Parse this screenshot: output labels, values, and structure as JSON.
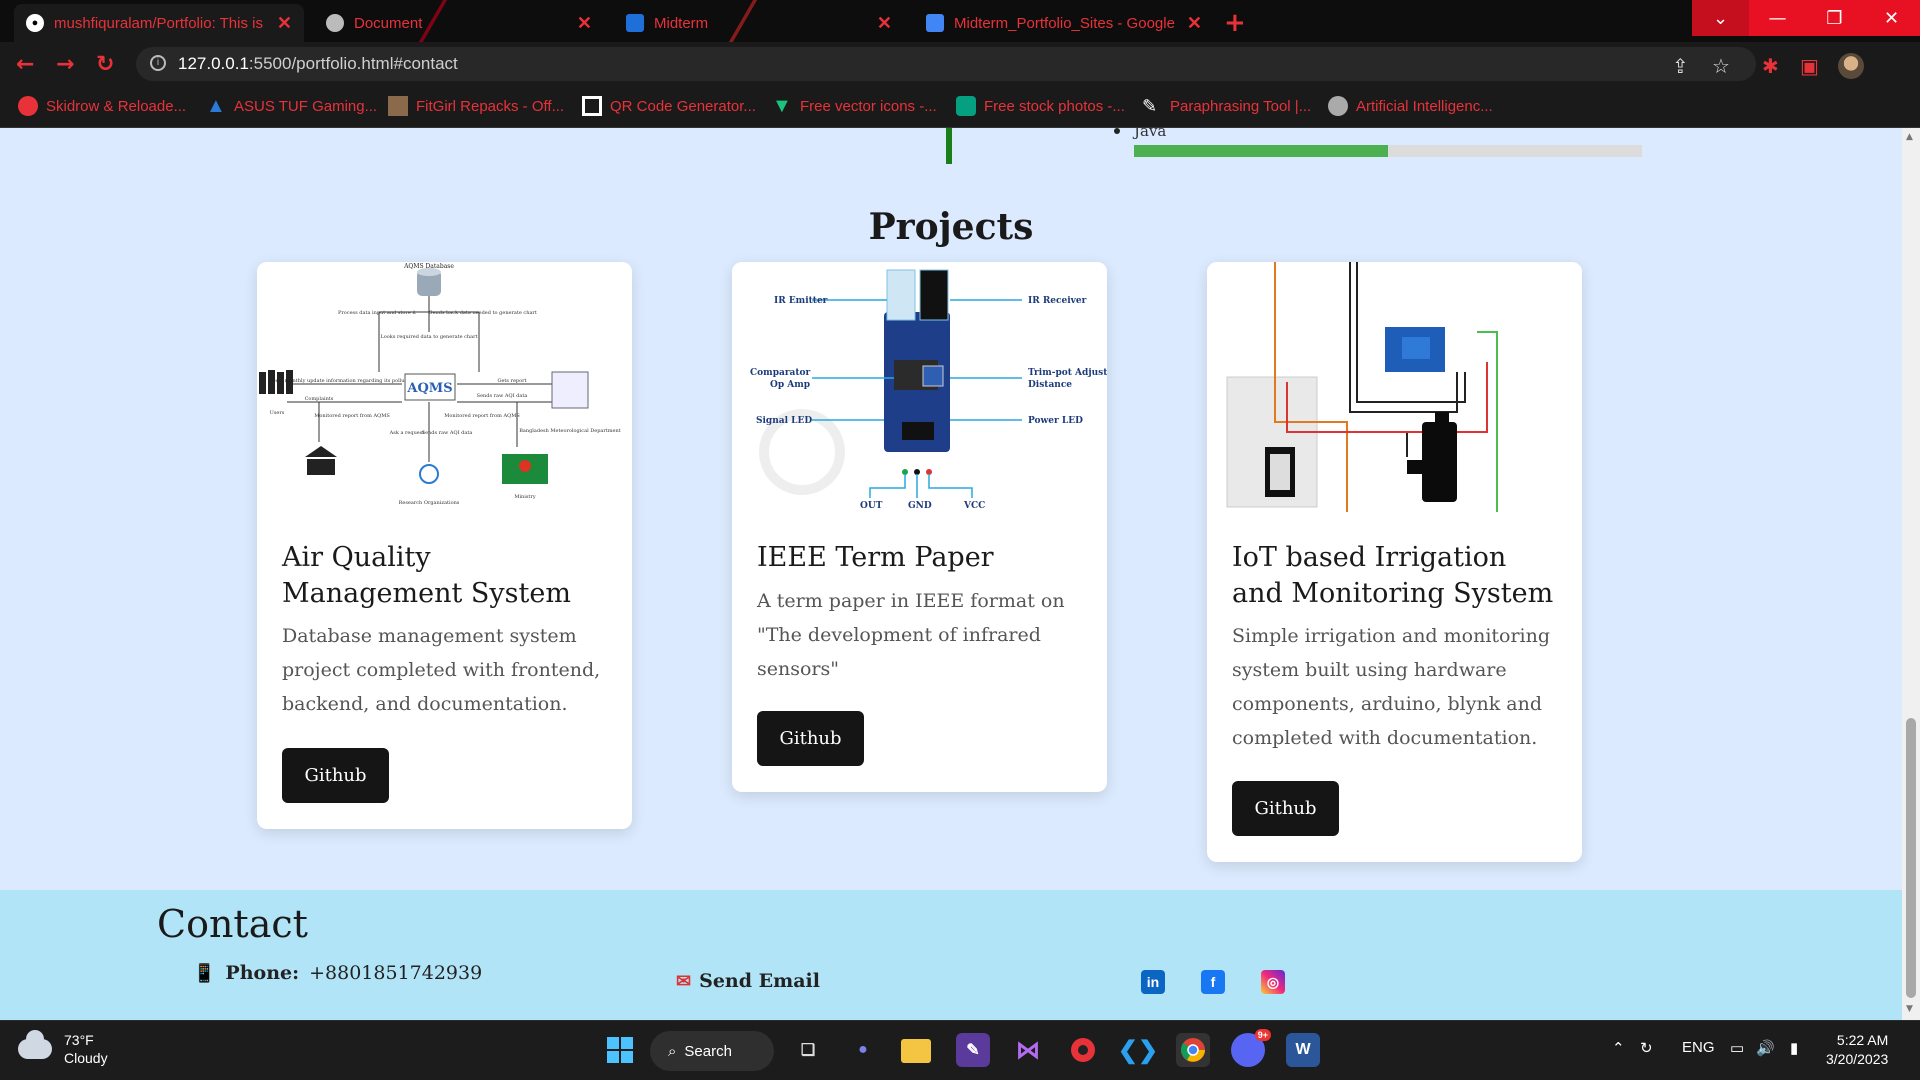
{
  "browser": {
    "tabs": [
      {
        "title": "mushfiquralam/Portfolio: This is a",
        "icon": "github-icon"
      },
      {
        "title": "Document",
        "icon": "globe-icon"
      },
      {
        "title": "Midterm",
        "icon": "classroom-icon"
      },
      {
        "title": "Midterm_Portfolio_Sites - Google",
        "icon": "docs-icon"
      }
    ],
    "url": {
      "host": "127.0.0.1",
      "path": ":5500/portfolio.html#contact"
    },
    "bookmarks": [
      "Skidrow & Reloade...",
      "ASUS TUF Gaming...",
      "FitGirl Repacks - Off...",
      "QR Code Generator...",
      "Free vector icons -...",
      "Free stock photos -...",
      "Paraphrasing Tool |...",
      "Artificial Intelligenc..."
    ],
    "accent_color": "#e8323a"
  },
  "skills": {
    "last_item": "Java",
    "last_item_level": 0.5
  },
  "projects": {
    "title": "Projects",
    "items": [
      {
        "title": "Air Quality Management System",
        "description": "Database management system project completed with frontend, backend, and documentation.",
        "button": "Github",
        "diagram": {
          "center": "AQMS",
          "labels": [
            "AQMS Database",
            "Process data input and store it",
            "Sends back data needed to generate chart",
            "Looks required data to generate chart",
            "Gets monthly update information regarding its pollution",
            "Complaints",
            "Gets report",
            "Sends raw AQI data",
            "Monitored report from AQMS",
            "Ask a request",
            "Sends raw AQI data",
            "Monitored report from AQMS",
            "Users",
            "Bangladesh Meteorological Department",
            "Research Organizations",
            "Ministry"
          ]
        }
      },
      {
        "title": "IEEE Term Paper",
        "description": "A term paper in IEEE format on \"The development of infrared sensors\"",
        "button": "Github",
        "diagram": {
          "left_labels": [
            "IR Emitter",
            "Comparator\nOp Amp",
            "Signal LED"
          ],
          "right_labels": [
            "IR Receiver",
            "Trim-pot Adjust\nDistance",
            "Power LED"
          ],
          "pins": [
            "OUT",
            "GND",
            "VCC"
          ]
        }
      },
      {
        "title": "IoT based Irrigation and Monitoring System",
        "description": "Simple irrigation and monitoring system built using hardware components, arduino, blynk and completed with documentation.",
        "button": "Github"
      }
    ]
  },
  "contact": {
    "title": "Contact",
    "phone_label": "Phone:",
    "phone_value": "+8801851742939",
    "email_label": "Send Email",
    "socials": [
      {
        "name": "LinkedIn",
        "glyph": "in",
        "color": "#0a66c2"
      },
      {
        "name": "Facebook",
        "glyph": "f",
        "color": "#1877f2"
      },
      {
        "name": "Instagram",
        "glyph": "◎",
        "color": "#e1306c"
      }
    ]
  },
  "taskbar": {
    "weather_temp": "73°F",
    "weather_desc": "Cloudy",
    "search_label": "Search",
    "language": "ENG",
    "time": "5:22 AM",
    "date": "3/20/2023",
    "discord_badge": "9+"
  }
}
